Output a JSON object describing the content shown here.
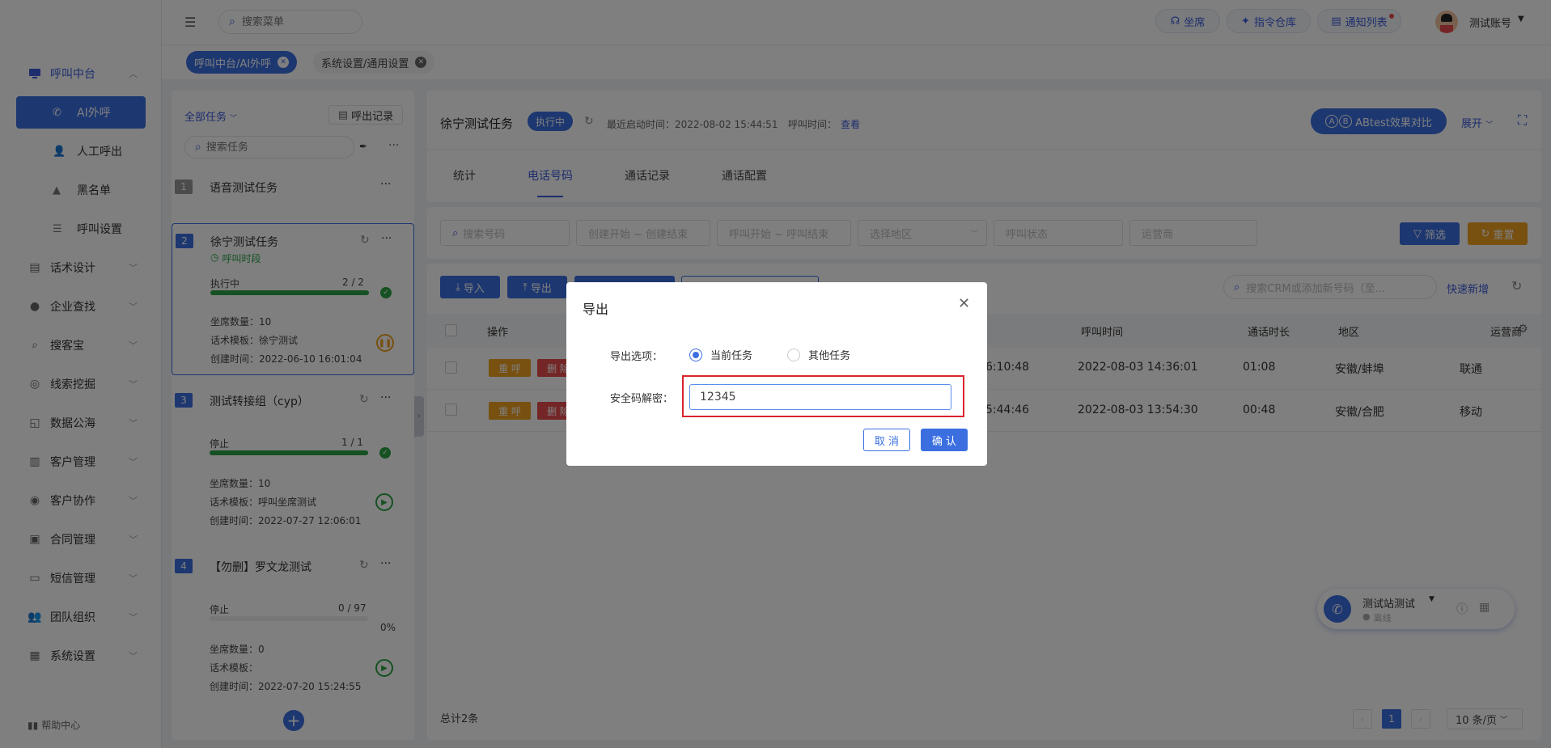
{
  "sidebar": {
    "groups": [
      {
        "label": "呼叫中台",
        "icon": "monitor-icon",
        "expanded": true
      },
      {
        "label": "话术设计",
        "icon": "script-icon"
      },
      {
        "label": "企业查找",
        "icon": "bulb-icon"
      },
      {
        "label": "搜客宝",
        "icon": "search-icon"
      },
      {
        "label": "线索挖掘",
        "icon": "target-icon"
      },
      {
        "label": "数据公海",
        "icon": "chart-icon"
      },
      {
        "label": "客户管理",
        "icon": "contacts-icon"
      },
      {
        "label": "客户协作",
        "icon": "team-icon"
      },
      {
        "label": "合同管理",
        "icon": "clipboard-icon"
      },
      {
        "label": "短信管理",
        "icon": "message-icon"
      },
      {
        "label": "团队组织",
        "icon": "people-icon"
      },
      {
        "label": "系统设置",
        "icon": "grid-icon"
      }
    ],
    "subitems": [
      {
        "label": "AI外呼",
        "icon": "phone-icon",
        "active": true
      },
      {
        "label": "人工呼出",
        "icon": "person-icon"
      },
      {
        "label": "黑名单",
        "icon": "warning-icon"
      },
      {
        "label": "呼叫设置",
        "icon": "sliders-icon"
      }
    ],
    "help": "帮助中心"
  },
  "topbar": {
    "search_placeholder": "搜索菜单",
    "buttons": [
      "坐席",
      "指令仓库",
      "通知列表"
    ],
    "account": "测试账号"
  },
  "tags": [
    {
      "label": "呼叫中台/AI外呼",
      "active": true
    },
    {
      "label": "系统设置/通用设置",
      "active": false
    }
  ],
  "tasks_panel": {
    "filter": "全部任务",
    "records_button": "呼出记录",
    "search_placeholder": "搜索任务",
    "more": "···",
    "tasks": [
      {
        "num": "1",
        "name": "语音测试任务"
      },
      {
        "num": "2",
        "name": "徐宁测试任务",
        "sub": "呼叫时段",
        "status": "执行中",
        "progress": "2 / 2",
        "progress_value": 1.0,
        "seats": "坐席数量：10",
        "template": "话术模板：徐宁测试",
        "created": "创建时间：2022-06-10 16:01:04",
        "selected": true
      },
      {
        "num": "3",
        "name": "测试转接组（cyp）",
        "status": "停止",
        "progress": "1 / 1",
        "progress_value": 1.0,
        "seats": "坐席数量：10",
        "template": "话术模板：呼叫坐席测试",
        "created": "创建时间：2022-07-27 12:06:01"
      },
      {
        "num": "4",
        "name": "【勿删】罗文龙测试",
        "status": "停止",
        "progress": "0 / 97",
        "progress_value": 0.0,
        "percent": "0%",
        "seats": "坐席数量：0",
        "template": "话术模板：",
        "created": "创建时间：2022-07-20 15:24:55"
      }
    ]
  },
  "task_header": {
    "title": "徐宁测试任务",
    "status": "执行中",
    "last_start": "最近启动时间：2022-08-02 15:44:51",
    "call_time_label": "呼叫时间：",
    "call_time_link": "查看",
    "abtest": "ABtest效果对比",
    "expand": "展开",
    "tabs": [
      "统计",
      "电话号码",
      "通话记录",
      "通话配置"
    ],
    "active_tab": 1
  },
  "filters": {
    "search_number": "搜索号码",
    "create_range": "创建开始 ~ 创建结束",
    "call_range": "呼叫开始 ~ 呼叫结束",
    "region": "选择地区",
    "call_status": "呼叫状态",
    "carrier": "运营商",
    "filter_btn": "筛选",
    "reset_btn": "重置"
  },
  "toolbar": {
    "import": "导入",
    "export": "导出",
    "crm_placeholder": "搜索CRM或添加新号码（至...",
    "quick_add": "快速新增"
  },
  "table": {
    "headers": [
      "操作",
      "呼叫时间",
      "通话时长",
      "地区",
      "运营商"
    ],
    "action_labels": [
      "重 呼",
      "删 除"
    ],
    "rows": [
      {
        "time_partial": "6:10:48",
        "call_time": "2022-08-03 14:36:01",
        "duration": "01:08",
        "region": "安徽/蚌埠",
        "carrier": "联通"
      },
      {
        "time_partial": "5:44:46",
        "call_time": "2022-08-03 13:54:30",
        "duration": "00:48",
        "region": "安徽/合肥",
        "carrier": "移动"
      }
    ],
    "total": "总计2条"
  },
  "pagination": {
    "current": "1",
    "page_size": "10 条/页"
  },
  "phone_widget": {
    "name": "测试站测试",
    "status": "离线"
  },
  "dialog": {
    "title": "导出",
    "option_label": "导出选项：",
    "options": [
      "当前任务",
      "其他任务"
    ],
    "selected_option": 0,
    "code_label": "安全码解密：",
    "code_value": "12345",
    "cancel": "取 消",
    "confirm": "确 认"
  },
  "colors": {
    "primary": "#3b6fe0",
    "success": "#2ba245",
    "warning": "#f0a020",
    "danger": "#e84a4a",
    "highlight": "#d9252c"
  }
}
